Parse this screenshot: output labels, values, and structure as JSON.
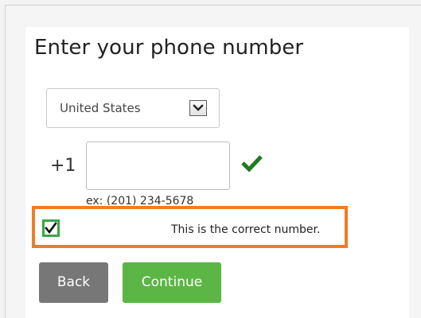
{
  "page": {
    "title": "Enter your phone number"
  },
  "country_select": {
    "selected": "United States",
    "icon": "chevron-down-icon"
  },
  "phone": {
    "country_code": "+1",
    "value": "",
    "hint": "ex: (201) 234-5678",
    "valid_icon": "checkmark-icon",
    "valid_color": "#1e7b1e"
  },
  "confirm": {
    "checked": true,
    "label": "This is the correct number.",
    "highlight_color": "#f07c24",
    "checkbox_color": "#37a64a"
  },
  "buttons": {
    "back_label": "Back",
    "continue_label": "Continue",
    "back_color": "#777777",
    "continue_color": "#5bb645"
  }
}
